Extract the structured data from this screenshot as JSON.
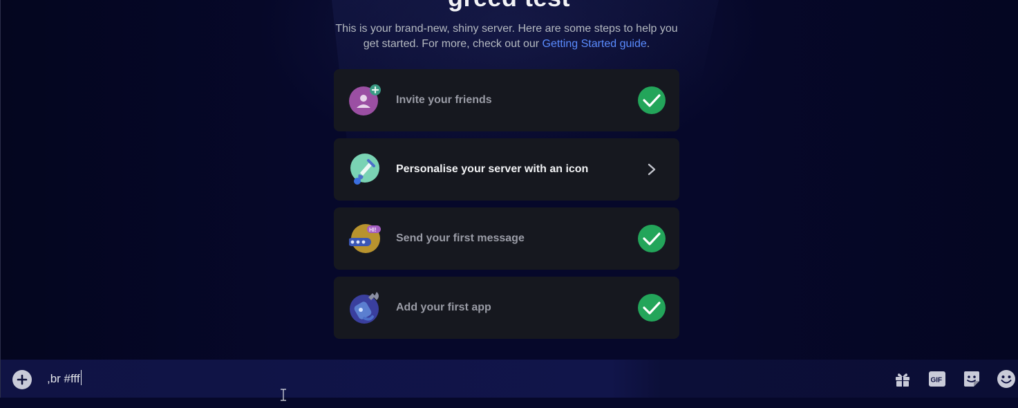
{
  "server": {
    "name": "greed test",
    "intro_text": "This is your brand-new, shiny server. Here are some steps to help you get started. For more, check out our ",
    "guide_link": "Getting Started guide",
    "intro_end": "."
  },
  "steps": [
    {
      "label": "Invite your friends",
      "status": "complete",
      "icon": "invite-friends-icon"
    },
    {
      "label": "Personalise your server with an icon",
      "status": "incomplete",
      "icon": "paintbrush-icon"
    },
    {
      "label": "Send your first message",
      "status": "complete",
      "icon": "message-icon"
    },
    {
      "label": "Add your first app",
      "status": "complete",
      "icon": "app-robot-icon"
    }
  ],
  "composer": {
    "input_value": ",br #fff",
    "tools": [
      "gift-icon",
      "gif-icon",
      "sticker-icon",
      "emoji-icon"
    ]
  },
  "colors": {
    "background": "#06082a",
    "card": "#16181f",
    "check_green": "#23a55a",
    "link_blue": "#5a8cff"
  }
}
